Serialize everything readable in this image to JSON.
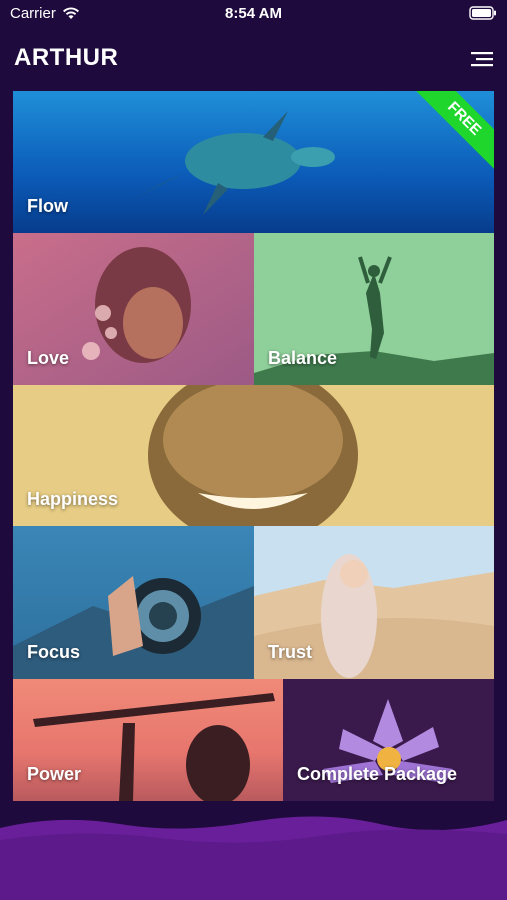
{
  "status_bar": {
    "carrier": "Carrier",
    "time": "8:54 AM"
  },
  "header": {
    "title": "ARTHUR"
  },
  "tiles": {
    "flow": {
      "label": "Flow",
      "badge": "FREE"
    },
    "love": {
      "label": "Love"
    },
    "balance": {
      "label": "Balance"
    },
    "happiness": {
      "label": "Happiness"
    },
    "focus": {
      "label": "Focus"
    },
    "trust": {
      "label": "Trust"
    },
    "power": {
      "label": "Power"
    },
    "complete": {
      "label": "Complete Package"
    }
  },
  "colors": {
    "background": "#1e0a3c",
    "badge": "#1fd62c"
  },
  "icons": {
    "wifi": "wifi-icon",
    "battery": "battery-icon",
    "menu": "menu-icon"
  }
}
